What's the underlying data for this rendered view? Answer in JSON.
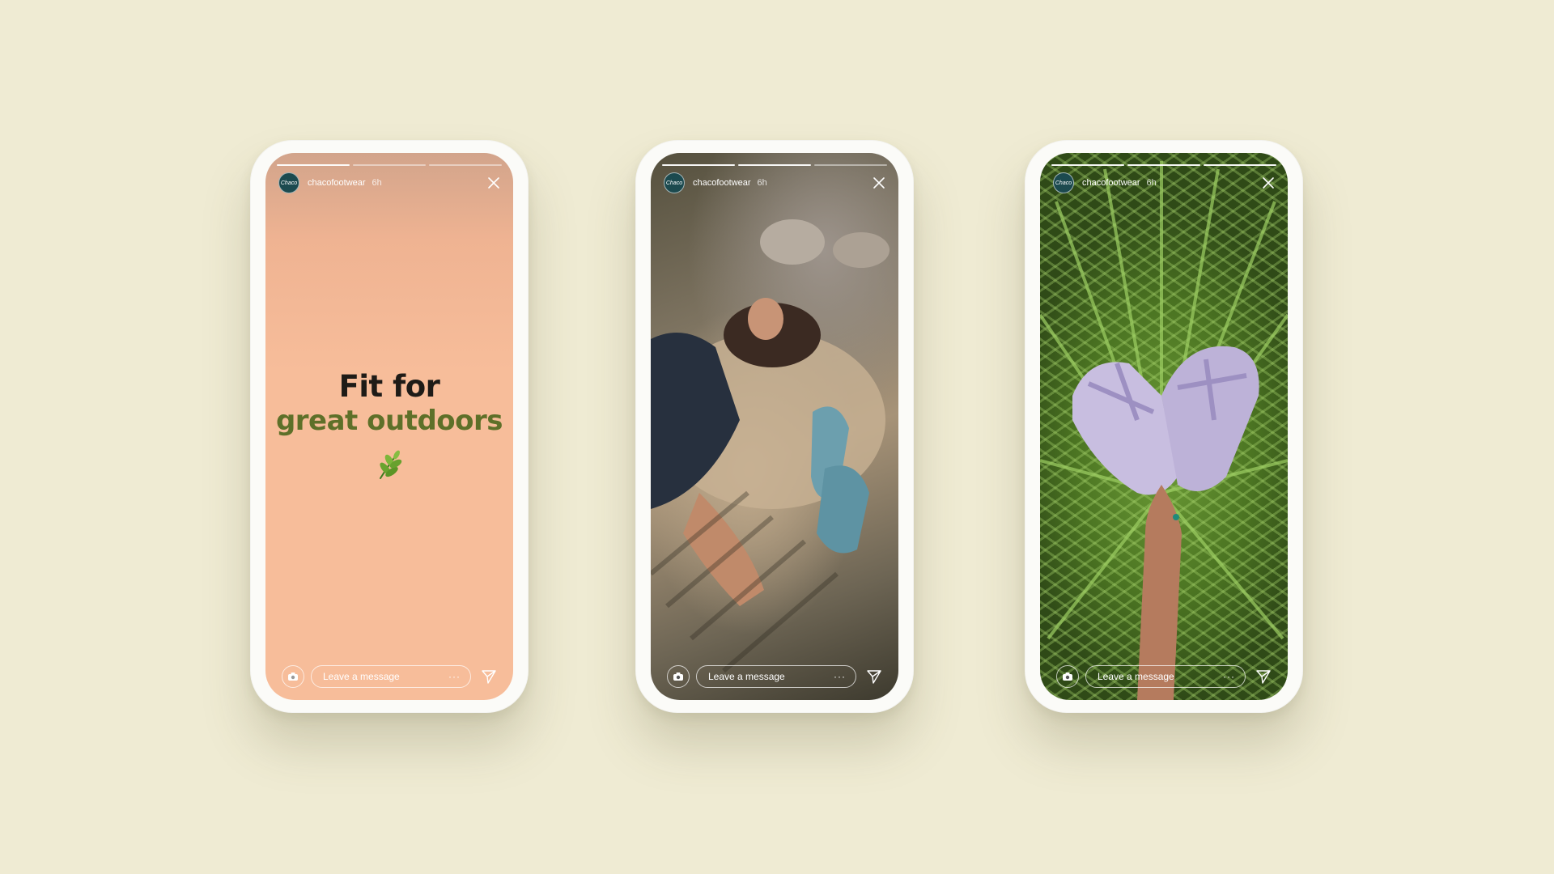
{
  "stories": [
    {
      "username": "chacofootwear",
      "time": "6h",
      "avatar_text": "Chaco",
      "headline_line1": "Fit for",
      "headline_line2": "great outdoors",
      "message_placeholder": "Leave a message",
      "more": "···",
      "progress_done": 0
    },
    {
      "username": "chacofootwear",
      "time": "6h",
      "avatar_text": "Chaco",
      "message_placeholder": "Leave a message",
      "more": "···",
      "progress_done": 1
    },
    {
      "username": "chacofootwear",
      "time": "6h",
      "avatar_text": "Chaco",
      "message_placeholder": "Leave a message",
      "more": "···",
      "progress_done": 2
    }
  ],
  "colors": {
    "background": "#efebd3",
    "headline_dark": "#1e1b17",
    "headline_green": "#5e7029",
    "story1_bg": "#f7bd9a"
  },
  "icons": [
    "camera-icon",
    "close-icon",
    "send-icon",
    "leaf-icon"
  ]
}
